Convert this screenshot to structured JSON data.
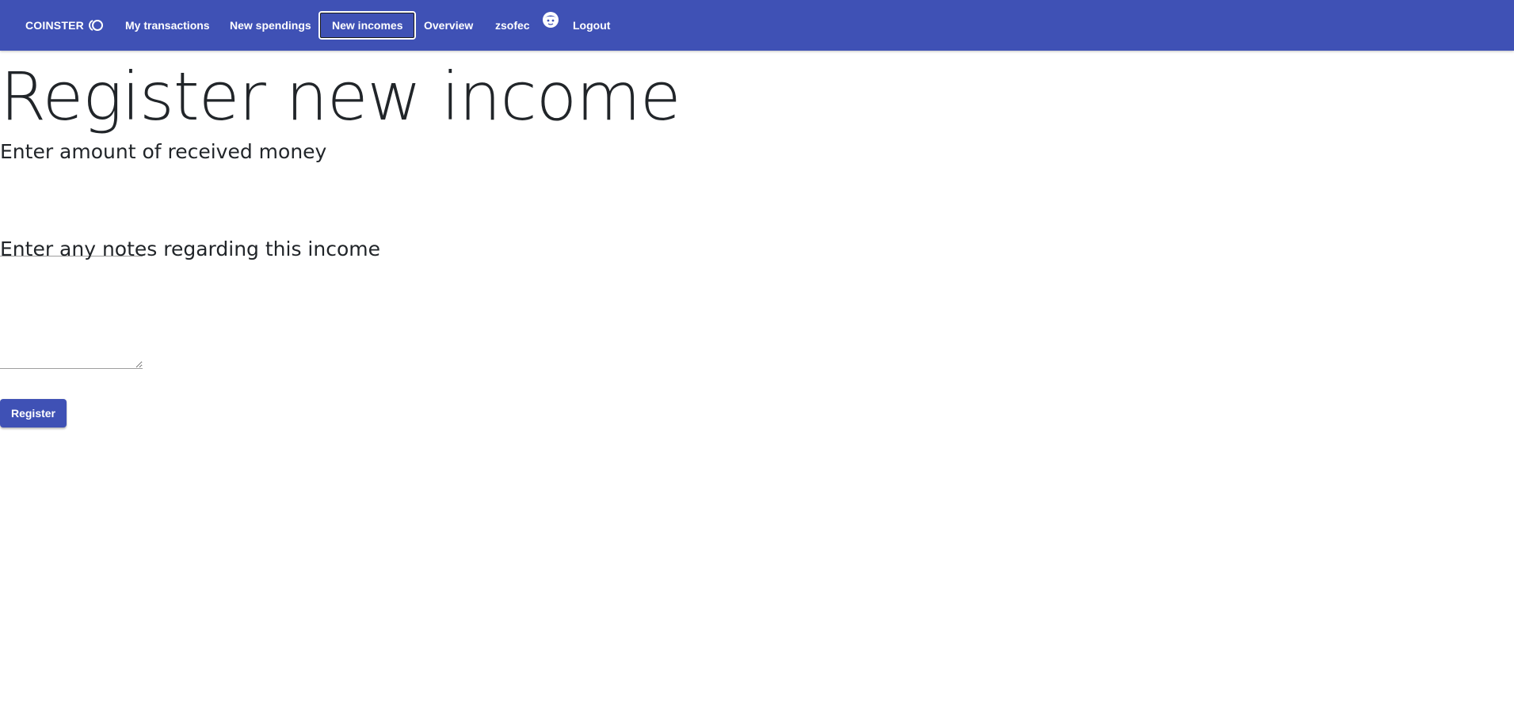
{
  "navbar": {
    "brand": "COINSTER",
    "brand_logo_icon": "coin-logo-icon",
    "links": [
      {
        "label": "My transactions",
        "active": false
      },
      {
        "label": "New spendings",
        "active": false
      },
      {
        "label": "New incomes",
        "active": true
      },
      {
        "label": "Overview",
        "active": false
      }
    ],
    "username": "zsofec",
    "avatar_icon": "user-avatar-icon",
    "logout_label": "Logout",
    "background_color": "#3f51b5"
  },
  "main": {
    "title": "Register new income",
    "amount_heading": "Enter amount of received money",
    "amount_value": "",
    "notes_heading": "Enter any notes regarding this income",
    "notes_value": "",
    "register_button_label": "Register",
    "button_color": "#3f51b5"
  }
}
